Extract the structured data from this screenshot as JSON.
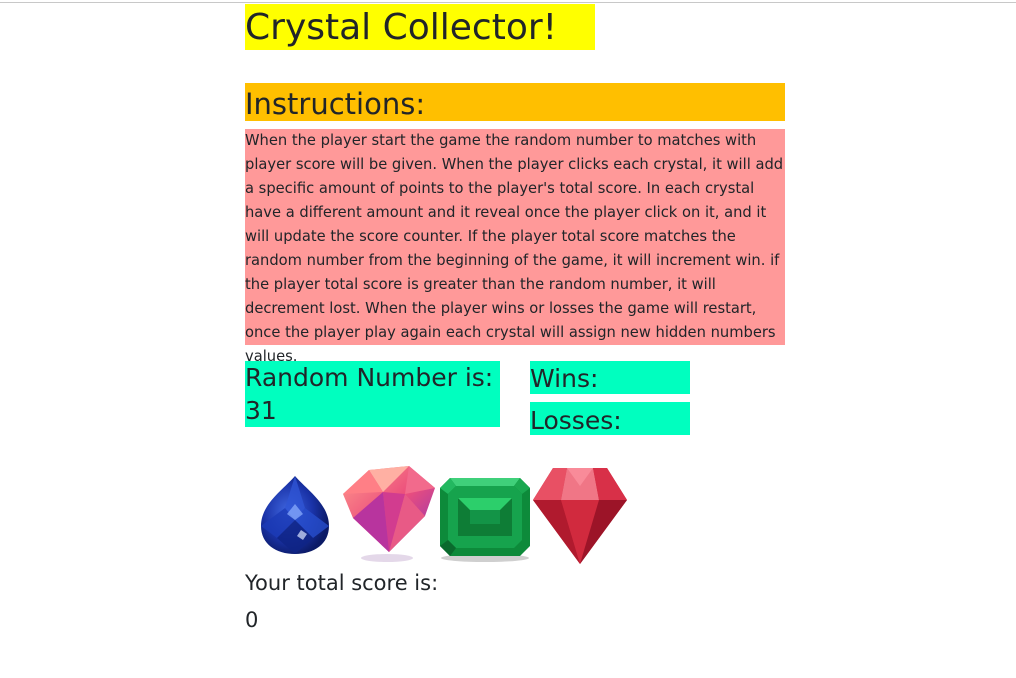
{
  "title": "Crystal Collector!",
  "instructions": {
    "heading": "Instructions:",
    "text": "When the player start the game the random number to matches with player score will be given. When the player clicks each crystal, it will add a specific amount of points to the player's total score. In each crystal have a different amount and it reveal once the player click on it, and it will update the score counter. If the player total score matches the random number from the beginning of the game, it will increment win. if the player total score is greater than the random number, it will decrement lost. When the player wins or losses the game will restart, once the player play again each crystal will assign new hidden numbers values."
  },
  "random": {
    "label": "Random Number is:",
    "value": "31"
  },
  "wins": {
    "label": "Wins:"
  },
  "losses": {
    "label": "Losses:"
  },
  "crystals": [
    {
      "icon": "blue-crystal-icon",
      "color": "#1a2fa8"
    },
    {
      "icon": "pink-diamond-icon",
      "color": "#e8456a"
    },
    {
      "icon": "green-emerald-icon",
      "color": "#13a84a"
    },
    {
      "icon": "red-ruby-icon",
      "color": "#d32a3a"
    }
  ],
  "score": {
    "label": "Your total score is:",
    "value": "0"
  },
  "colors": {
    "title_bg": "#ffff00",
    "instructions_heading_bg": "#ffbf00",
    "instructions_body_bg": "#ff9999",
    "counter_bg": "#00ffbf"
  }
}
